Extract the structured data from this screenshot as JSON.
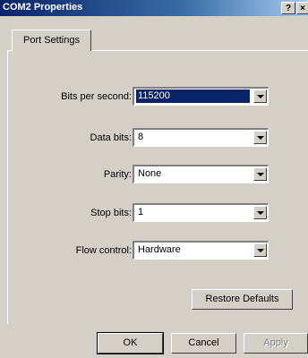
{
  "window": {
    "title": "COM2 Properties",
    "help_glyph": "?",
    "close_glyph": "×"
  },
  "tabs": [
    {
      "label": "Port Settings"
    }
  ],
  "fields": {
    "bits_per_second": {
      "label": "Bits per second:",
      "value": "115200"
    },
    "data_bits": {
      "label": "Data bits:",
      "value": "8"
    },
    "parity": {
      "label": "Parity:",
      "value": "None"
    },
    "stop_bits": {
      "label": "Stop bits:",
      "value": "1"
    },
    "flow_control": {
      "label": "Flow control:",
      "value": "Hardware"
    }
  },
  "buttons": {
    "restore_defaults": "Restore Defaults",
    "ok": "OK",
    "cancel": "Cancel",
    "apply": "Apply"
  }
}
